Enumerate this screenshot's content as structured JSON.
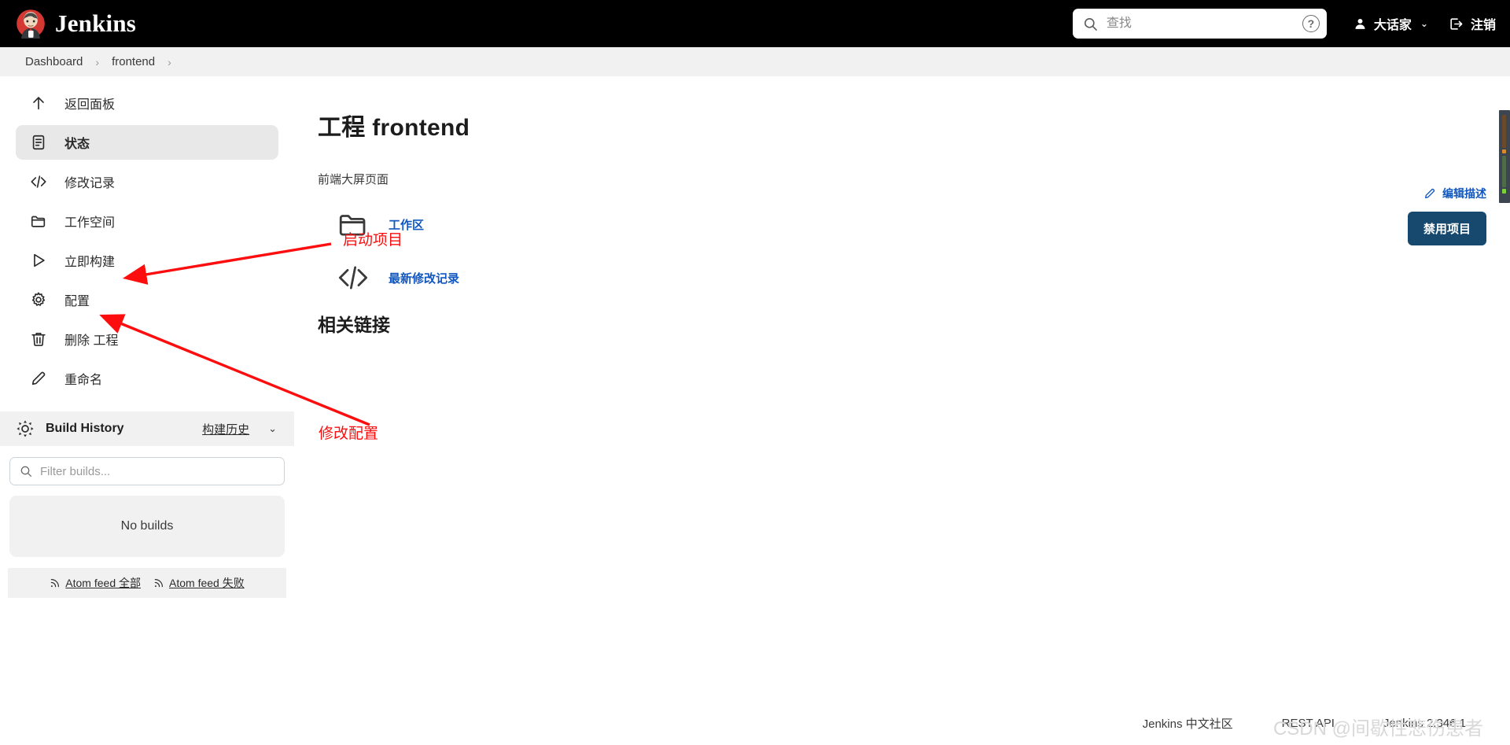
{
  "header": {
    "brand": "Jenkins",
    "logo_icon": "jenkins-butler-logo",
    "search": {
      "placeholder": "查找",
      "value": "",
      "icon": "search-icon"
    },
    "help_icon": "help-question-icon",
    "help_label": "?",
    "user": {
      "name": "大话家",
      "icon": "person-icon",
      "chevron": "⌄"
    },
    "logout": {
      "label": "注销",
      "icon": "logout-icon"
    }
  },
  "breadcrumb": {
    "items": [
      "Dashboard",
      "frontend"
    ],
    "separator": "›",
    "trailing_separator": "›"
  },
  "sidebar": {
    "items": [
      {
        "label": "返回面板",
        "icon": "arrow-up-icon",
        "active": false
      },
      {
        "label": "状态",
        "icon": "document-status-icon",
        "active": true
      },
      {
        "label": "修改记录",
        "icon": "code-brackets-icon",
        "active": false
      },
      {
        "label": "工作空间",
        "icon": "folder-icon",
        "active": false
      },
      {
        "label": "立即构建",
        "icon": "play-triangle-icon",
        "active": false
      },
      {
        "label": "配置",
        "icon": "gear-icon",
        "active": false
      },
      {
        "label": "删除 工程",
        "icon": "trash-icon",
        "active": false
      },
      {
        "label": "重命名",
        "icon": "pencil-icon",
        "active": false
      }
    ],
    "build_history": {
      "icon": "build-history-sun-icon",
      "title": "Build History",
      "link": "构建历史",
      "chevron": "⌄",
      "filter": {
        "placeholder": "Filter builds...",
        "value": "",
        "icon": "search-icon"
      },
      "empty_text": "No builds",
      "feeds": [
        {
          "label": "Atom feed 全部",
          "icon": "rss-icon"
        },
        {
          "label": "Atom feed 失败",
          "icon": "rss-icon"
        }
      ]
    }
  },
  "main": {
    "title": "工程 frontend",
    "description": "前端大屏页面",
    "links": [
      {
        "label": "工作区",
        "icon": "folder-icon"
      },
      {
        "label": "最新修改记录",
        "icon": "code-brackets-icon"
      }
    ],
    "section_heading": "相关链接"
  },
  "actions": {
    "edit_description": {
      "label": "编辑描述",
      "icon": "pencil-icon"
    },
    "disable_project": {
      "label": "禁用项目",
      "color": "#17496e"
    }
  },
  "annotations": {
    "color": "#fd0d0d",
    "items": [
      {
        "text": "启动项目"
      },
      {
        "text": "修改配置"
      }
    ]
  },
  "footer": {
    "links": [
      "Jenkins 中文社区",
      "REST API"
    ],
    "version": "Jenkins 2.346.1",
    "watermark": "CSDN @间歇性悲伤患者"
  }
}
